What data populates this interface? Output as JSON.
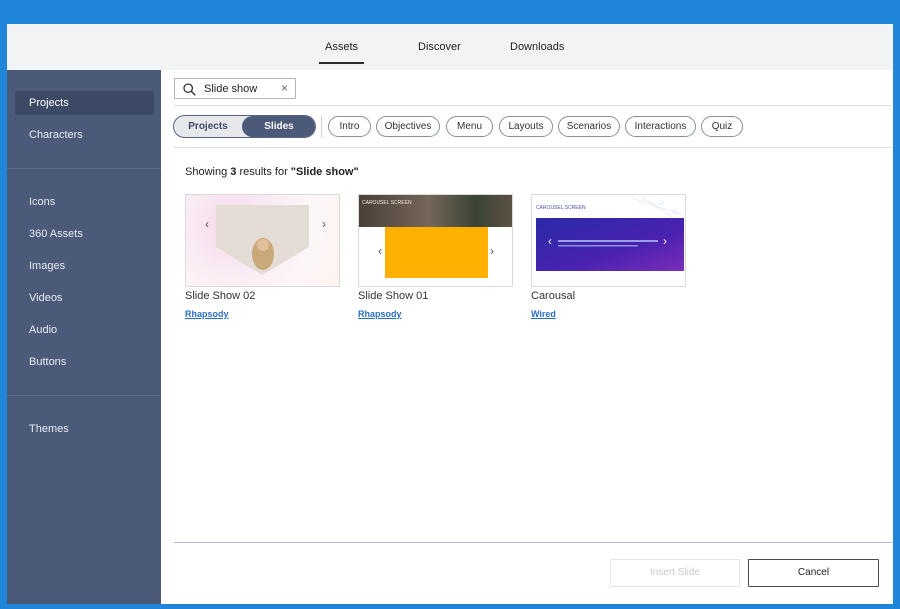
{
  "tabs": [
    {
      "label": "Assets",
      "active": true
    },
    {
      "label": "Discover",
      "active": false
    },
    {
      "label": "Downloads",
      "active": false
    }
  ],
  "sidebar": {
    "items": [
      {
        "label": "Projects",
        "active": true
      },
      {
        "label": "Characters"
      },
      {
        "label": "Icons"
      },
      {
        "label": "360 Assets"
      },
      {
        "label": "Images"
      },
      {
        "label": "Videos"
      },
      {
        "label": "Audio"
      },
      {
        "label": "Buttons"
      },
      {
        "label": "Themes"
      }
    ]
  },
  "search": {
    "value": "Slide show",
    "clear_icon": "close-icon"
  },
  "toggle": {
    "left": "Projects",
    "right": "Slides",
    "selected": "Slides"
  },
  "filters": [
    "Intro",
    "Objectives",
    "Menu",
    "Layouts",
    "Scenarios",
    "Interactions",
    "Quiz"
  ],
  "results": {
    "prefix": "Showing ",
    "count": "3",
    "middle": " results for ",
    "query": "\"Slide show\""
  },
  "cards": [
    {
      "title": "Slide Show 02",
      "link": "Rhapsody"
    },
    {
      "title": "Slide Show 01",
      "link": "Rhapsody",
      "thumb_heading": "CAROUSEL SCREEN"
    },
    {
      "title": "Carousal",
      "link": "Wired",
      "thumb_heading": "CAROUSEL SCREEN"
    }
  ],
  "buttons": {
    "insert": "Insert Slide",
    "cancel": "Cancel"
  },
  "colors": {
    "sidebar": "#4b5a78",
    "accent_blue": "#1f86d9",
    "link": "#2a6fc9",
    "slide_yellow": "#ffb000"
  }
}
